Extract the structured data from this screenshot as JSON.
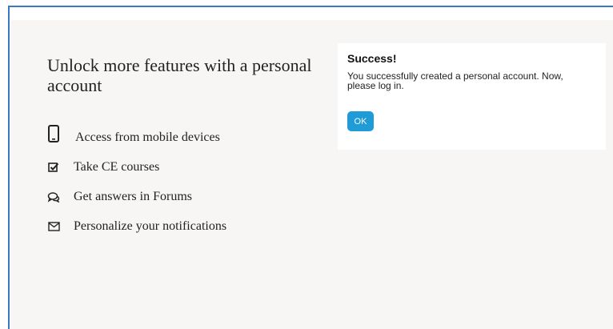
{
  "features": {
    "heading": "Unlock more features with a personal account",
    "items": [
      {
        "icon": "mobile-phone-icon",
        "label": "Access from mobile devices"
      },
      {
        "icon": "checkbox-checked-icon",
        "label": "Take CE courses"
      },
      {
        "icon": "comments-icon",
        "label": "Get answers in Forums"
      },
      {
        "icon": "envelope-icon",
        "label": "Personalize your notifications"
      }
    ]
  },
  "dialog": {
    "title": "Success!",
    "message": "You successfully created a personal account. Now, please log in.",
    "ok_label": "OK"
  },
  "colors": {
    "frame_border": "#3a78c2",
    "panel_background": "#f7f6f4",
    "ok_button": "#1f9bd8"
  }
}
